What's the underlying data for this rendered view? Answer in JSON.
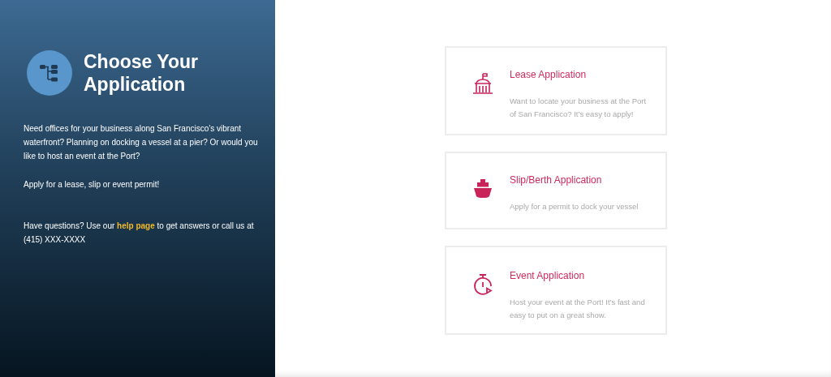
{
  "sidebar": {
    "title": "Choose Your Application",
    "paragraphs": [
      "Need offices for your business along San Francisco’s vibrant waterfront? Planning on docking a vessel at a pier? Or would you like to host an event at the Port?",
      "Apply for a lease, slip or event permit!"
    ],
    "contact": {
      "before": "Have questions? Use our",
      "link": "help page",
      "after": "to get answers or call us at (415) XXX-XXXX"
    }
  },
  "cards": [
    {
      "kind": "lease",
      "title": "Lease Application",
      "description": "Want to locate your business at the Port of San Francisco? It’s easy to apply!"
    },
    {
      "kind": "slip",
      "title": "Slip/Berth Application",
      "description": "Apply for a permit to dock your vessel"
    },
    {
      "kind": "event",
      "title": "Event Application",
      "description": "Host your event at the Port! It’s fast and easy to put on a great show."
    }
  ]
}
